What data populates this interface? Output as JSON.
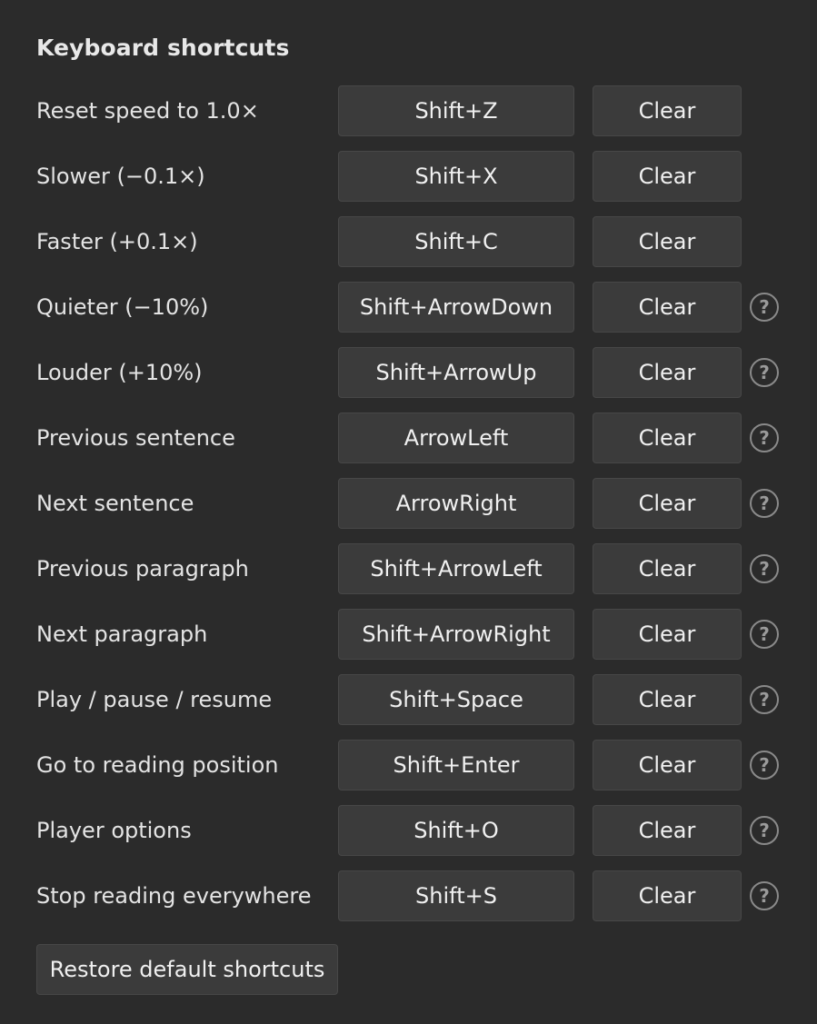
{
  "title": "Keyboard shortcuts",
  "shortcuts": [
    {
      "label": "Reset speed to 1.0×",
      "key": "Shift+Z",
      "clear": "Clear",
      "help": false
    },
    {
      "label": "Slower (−0.1×)",
      "key": "Shift+X",
      "clear": "Clear",
      "help": false
    },
    {
      "label": "Faster (+0.1×)",
      "key": "Shift+C",
      "clear": "Clear",
      "help": false
    },
    {
      "label": "Quieter (−10%)",
      "key": "Shift+ArrowDown",
      "clear": "Clear",
      "help": true
    },
    {
      "label": "Louder (+10%)",
      "key": "Shift+ArrowUp",
      "clear": "Clear",
      "help": true
    },
    {
      "label": "Previous sentence",
      "key": "ArrowLeft",
      "clear": "Clear",
      "help": true
    },
    {
      "label": "Next sentence",
      "key": "ArrowRight",
      "clear": "Clear",
      "help": true
    },
    {
      "label": "Previous paragraph",
      "key": "Shift+ArrowLeft",
      "clear": "Clear",
      "help": true
    },
    {
      "label": "Next paragraph",
      "key": "Shift+ArrowRight",
      "clear": "Clear",
      "help": true
    },
    {
      "label": "Play / pause / resume",
      "key": "Shift+Space",
      "clear": "Clear",
      "help": true
    },
    {
      "label": "Go to reading position",
      "key": "Shift+Enter",
      "clear": "Clear",
      "help": true
    },
    {
      "label": "Player options",
      "key": "Shift+O",
      "clear": "Clear",
      "help": true
    },
    {
      "label": "Stop reading everywhere",
      "key": "Shift+S",
      "clear": "Clear",
      "help": true
    }
  ],
  "help_glyph": "?",
  "help_icon": "question-circle-icon",
  "restore_label": "Restore default shortcuts",
  "colors": {
    "background": "#2b2b2b",
    "button": "#3b3b3b",
    "text": "#e6e6e6"
  }
}
